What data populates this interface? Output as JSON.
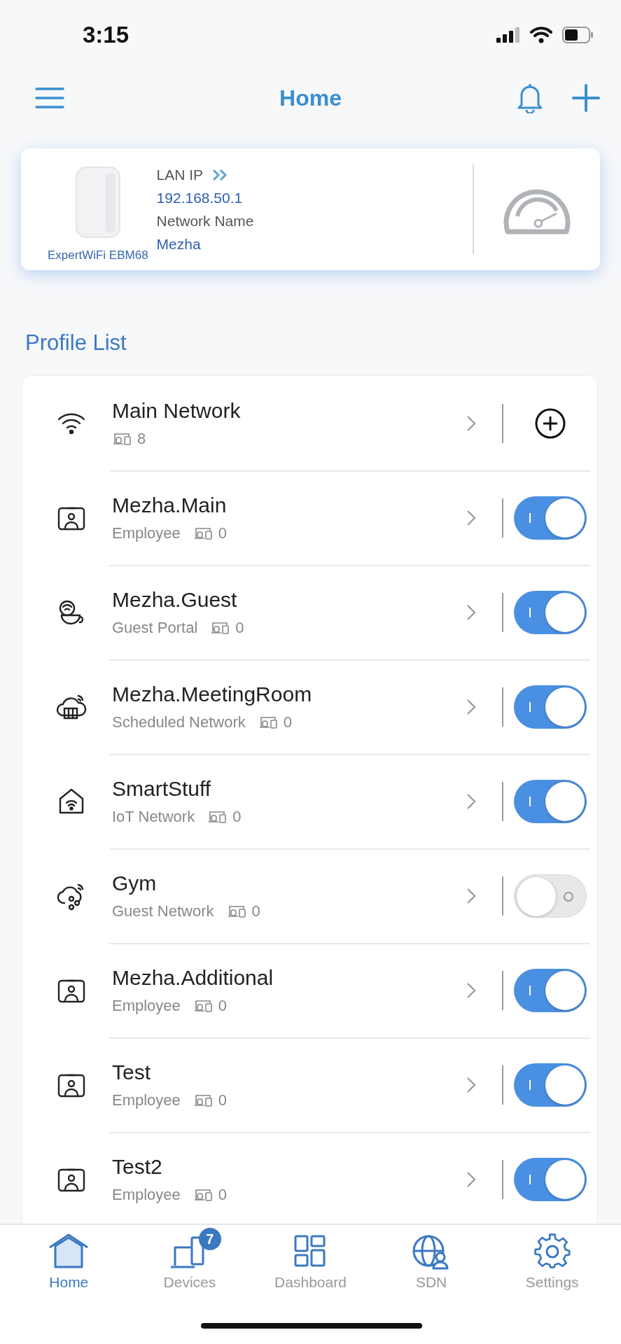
{
  "status_bar": {
    "time": "3:15"
  },
  "header": {
    "title": "Home"
  },
  "router_card": {
    "model": "ExpertWiFi EBM68",
    "lan_ip_label": "LAN IP",
    "lan_ip": "192.168.50.1",
    "network_name_label": "Network Name",
    "network_name": "Mezha"
  },
  "profile_list": {
    "title": "Profile List",
    "items": [
      {
        "kind": "wifi",
        "name": "Main Network",
        "devices": "8"
      },
      {
        "kind": "badge",
        "name": "Mezha.Main",
        "type": "Employee",
        "devices": "0",
        "on": true
      },
      {
        "kind": "guest",
        "name": "Mezha.Guest",
        "type": "Guest Portal",
        "devices": "0",
        "on": true
      },
      {
        "kind": "schedule",
        "name": "Mezha.MeetingRoom",
        "type": "Scheduled Network",
        "devices": "0",
        "on": true
      },
      {
        "kind": "iot",
        "name": "SmartStuff",
        "type": "IoT Network",
        "devices": "0",
        "on": true
      },
      {
        "kind": "share",
        "name": "Gym",
        "type": "Guest Network",
        "devices": "0",
        "on": false
      },
      {
        "kind": "badge",
        "name": "Mezha.Additional",
        "type": "Employee",
        "devices": "0",
        "on": true
      },
      {
        "kind": "badge",
        "name": "Test",
        "type": "Employee",
        "devices": "0",
        "on": true
      },
      {
        "kind": "badge",
        "name": "Test2",
        "type": "Employee",
        "devices": "0",
        "on": true
      }
    ]
  },
  "tab_bar": [
    {
      "kind": "home",
      "label": "Home",
      "selected": true
    },
    {
      "kind": "devices",
      "label": "Devices",
      "badge": "7",
      "selected": false
    },
    {
      "kind": "dashboard",
      "label": "Dashboard",
      "selected": false
    },
    {
      "kind": "sdn",
      "label": "SDN",
      "selected": false
    },
    {
      "kind": "settings",
      "label": "Settings",
      "selected": false
    }
  ]
}
